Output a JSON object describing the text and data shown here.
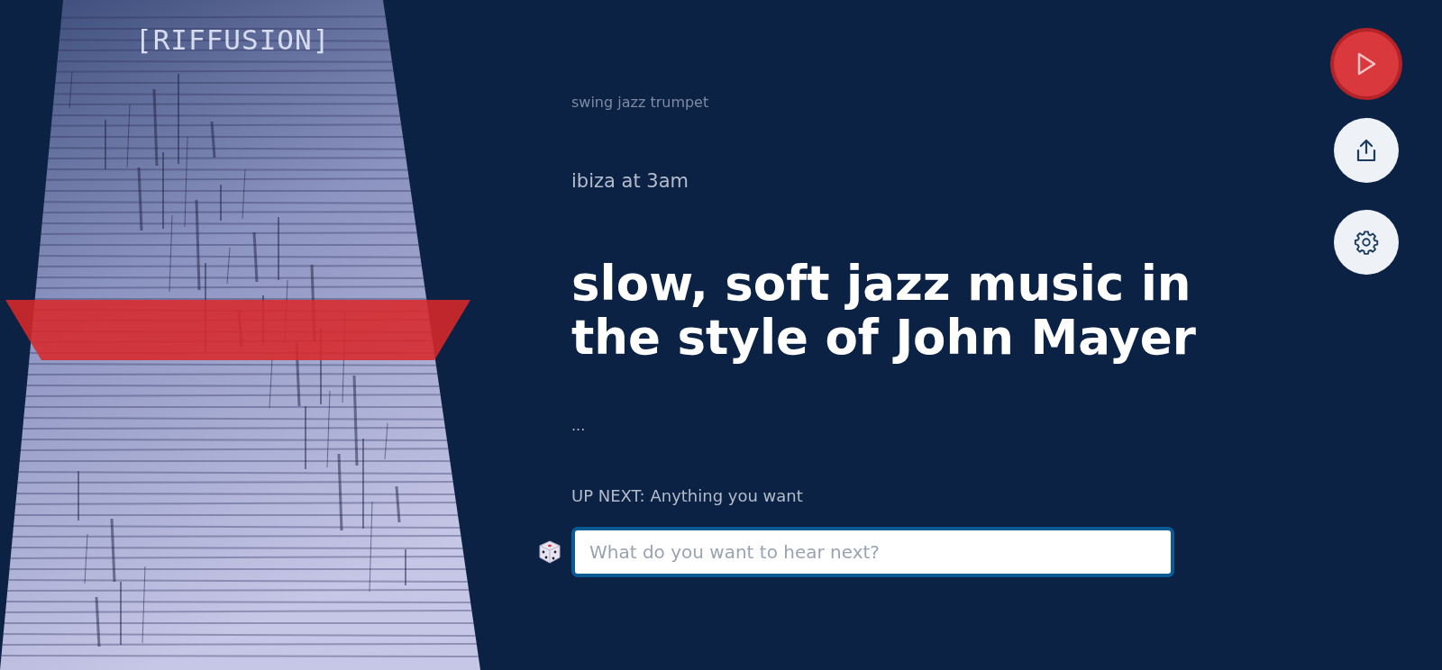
{
  "logo": "[RIFFUSION]",
  "prompts": [
    {
      "text": "swing jazz trumpet",
      "kind": "past"
    },
    {
      "text": "ibiza at 3am",
      "kind": "recent"
    },
    {
      "text": "slow, soft jazz music in the style of John Mayer",
      "kind": "current"
    },
    {
      "text": "...",
      "kind": "pending"
    }
  ],
  "up_next": "UP NEXT: Anything you want",
  "prompt_input": {
    "placeholder": "What do you want to hear next?"
  },
  "buttons": [
    {
      "kind": "play"
    },
    {
      "kind": "share"
    },
    {
      "kind": "settings"
    }
  ]
}
